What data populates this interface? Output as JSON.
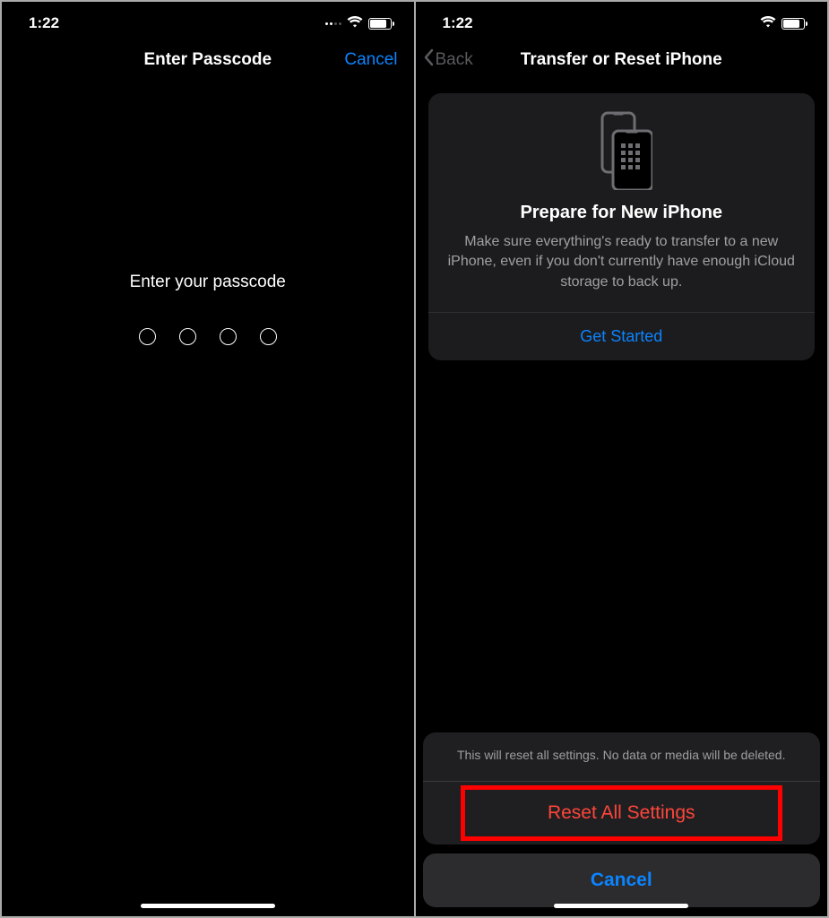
{
  "status": {
    "time": "1:22",
    "battery": "77"
  },
  "left": {
    "nav_title": "Enter Passcode",
    "cancel": "Cancel",
    "prompt": "Enter your passcode"
  },
  "right": {
    "back": "Back",
    "nav_title": "Transfer or Reset iPhone",
    "card": {
      "title": "Prepare for New iPhone",
      "desc": "Make sure everything's ready to transfer to a new iPhone, even if you don't currently have enough iCloud storage to back up.",
      "action": "Get Started"
    },
    "sheet": {
      "message": "This will reset all settings. No data or media will be deleted.",
      "reset": "Reset All Settings",
      "cancel": "Cancel"
    }
  },
  "colors": {
    "accent": "#0a84ff",
    "destructive": "#ff453a",
    "highlight": "#ff0000"
  }
}
